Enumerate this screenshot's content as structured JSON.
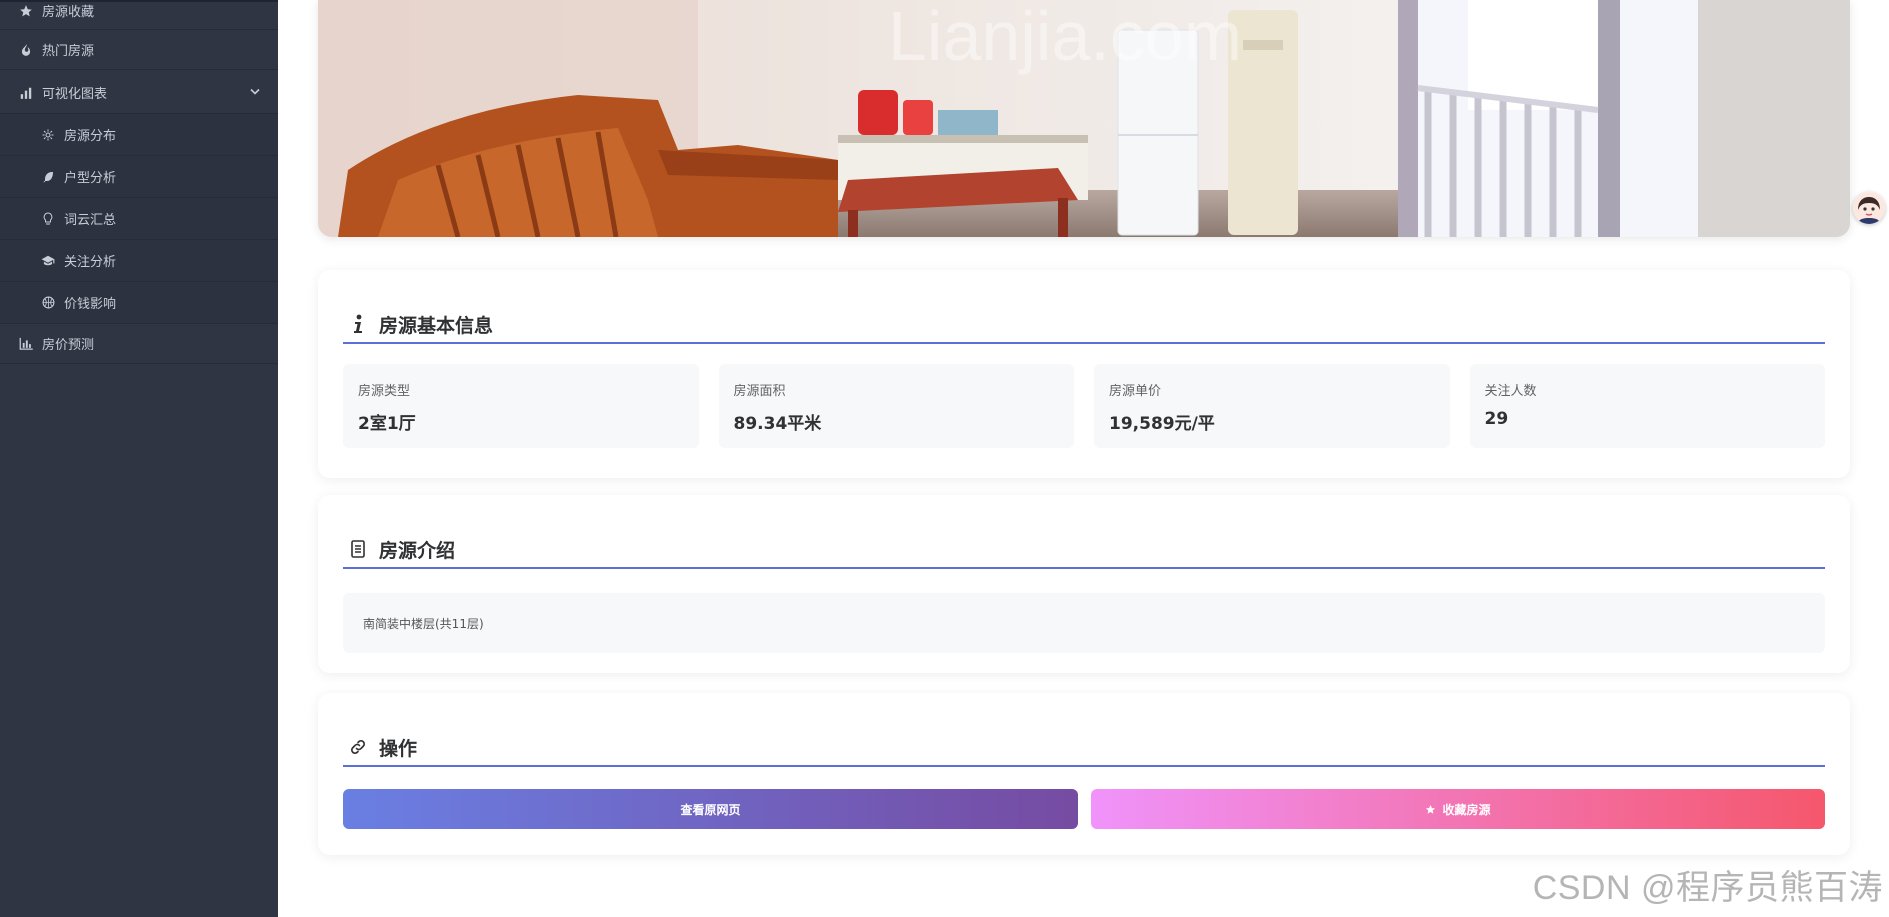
{
  "sidebar": {
    "items": [
      {
        "label": "房源收藏",
        "icon": "star-icon"
      },
      {
        "label": "热门房源",
        "icon": "fire-icon"
      },
      {
        "label": "可视化图表",
        "icon": "bar-chart-icon",
        "expanded": true,
        "children": [
          {
            "label": "房源分布",
            "icon": "sun-icon"
          },
          {
            "label": "户型分析",
            "icon": "feather-icon"
          },
          {
            "label": "词云汇总",
            "icon": "lightbulb-icon"
          },
          {
            "label": "关注分析",
            "icon": "graduation-cap-icon"
          },
          {
            "label": "价钱影响",
            "icon": "basketball-icon"
          }
        ]
      },
      {
        "label": "房价预测",
        "icon": "chart-column-icon"
      }
    ]
  },
  "hero": {
    "watermark_text": "Lianjia.com"
  },
  "basic_info": {
    "title": "房源基本信息",
    "fields": [
      {
        "label": "房源类型",
        "value": "2室1厅"
      },
      {
        "label": "房源面积",
        "value": "89.34平米"
      },
      {
        "label": "房源单价",
        "value": "19,589元/平"
      },
      {
        "label": "关注人数",
        "value": "29"
      }
    ]
  },
  "intro": {
    "title": "房源介绍",
    "text": "南简装中楼层(共11层)"
  },
  "actions": {
    "title": "操作",
    "view_label": "查看原网页",
    "favorite_label": "收藏房源"
  },
  "watermark": "CSDN @程序员熊百涛",
  "colors": {
    "sidebar_bg": "#2f3542",
    "accent": "#5b6fd6",
    "view_gradient": [
      "#6a7fe3",
      "#764ba2"
    ],
    "fav_gradient": [
      "#f093fb",
      "#f5576c"
    ]
  }
}
